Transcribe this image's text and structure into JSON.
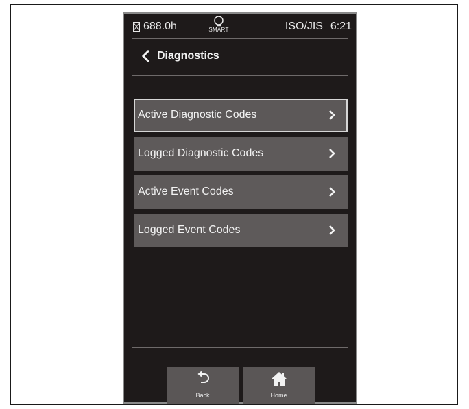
{
  "status_bar": {
    "hour_meter": "688.0h",
    "smart_label": "SMART",
    "standard": "ISO/JIS",
    "time": "6:21",
    "icons": [
      "hourglass-icon",
      "lightbulb-icon"
    ]
  },
  "header": {
    "title": "Diagnostics",
    "back_icon": "chevron-left-icon"
  },
  "menu": {
    "items": [
      {
        "label": "Active Diagnostic Codes",
        "selected": true
      },
      {
        "label": "Logged Diagnostic Codes",
        "selected": false
      },
      {
        "label": "Active Event Codes",
        "selected": false
      },
      {
        "label": "Logged Event Codes",
        "selected": false
      }
    ],
    "item_icon": "chevron-right-icon"
  },
  "bottom_nav": {
    "back_label": "Back",
    "home_label": "Home",
    "back_icon": "return-arrow-icon",
    "home_icon": "home-icon"
  },
  "colors": {
    "screen_bg": "#1e1a1a",
    "button_bg": "#5e5a5a",
    "text": "#f2f2f2",
    "selected_border": "#d6d6d6"
  }
}
